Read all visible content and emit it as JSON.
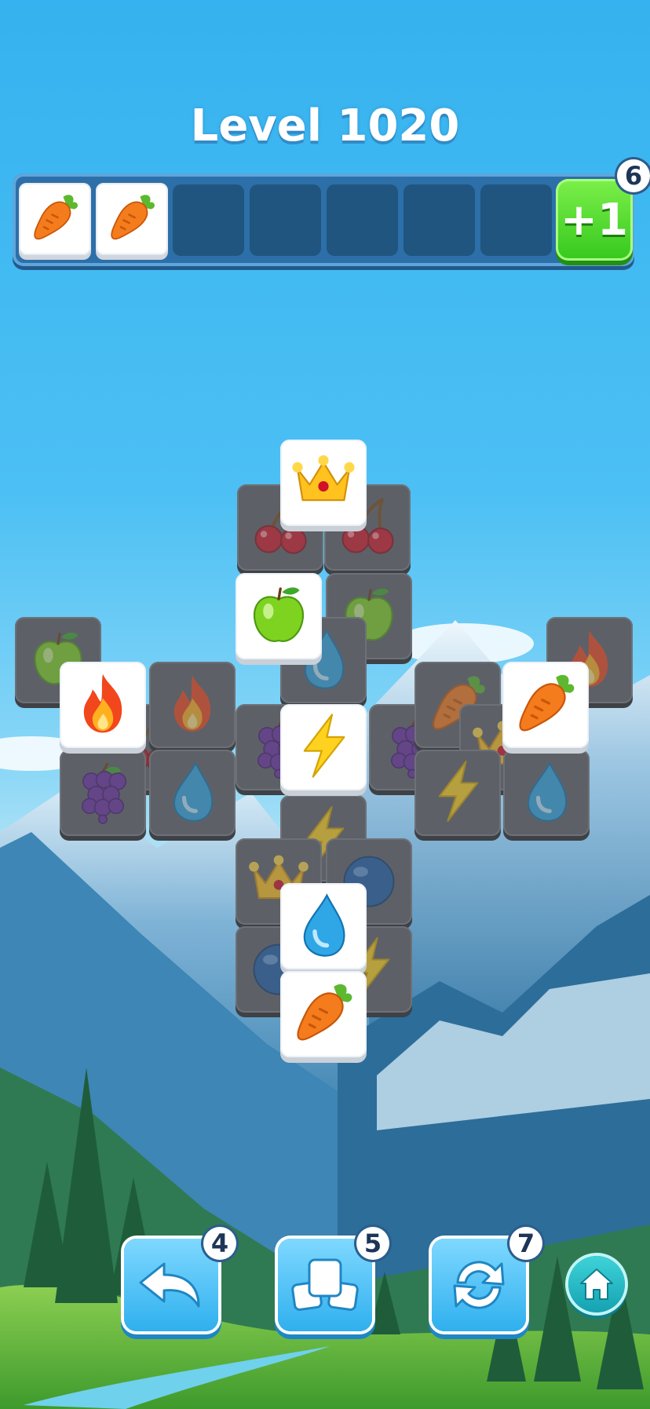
{
  "level": {
    "title": "Level 1020"
  },
  "tray": {
    "slots": [
      "carrot",
      "carrot",
      "",
      "",
      "",
      "",
      ""
    ],
    "extra_slot": {
      "label": "+1",
      "count": "6"
    }
  },
  "tools": {
    "undo": {
      "count": "4",
      "icon": "undo-icon"
    },
    "stack": {
      "count": "5",
      "icon": "stack-icon"
    },
    "shuffle": {
      "count": "7",
      "icon": "shuffle-icon"
    },
    "home": {
      "icon": "home-icon"
    }
  },
  "board": {
    "tiles": [
      {
        "icon": "apple",
        "state": "blocked"
      },
      {
        "icon": "fire",
        "state": "blocked"
      },
      {
        "icon": "cherry",
        "state": "blocked"
      },
      {
        "icon": "fire",
        "state": "blocked"
      },
      {
        "icon": "grapes",
        "state": "blocked"
      },
      {
        "icon": "drop",
        "state": "blocked"
      },
      {
        "icon": "cherry",
        "state": "blocked"
      },
      {
        "icon": "fire",
        "state": "blocked"
      },
      {
        "icon": "cherry",
        "state": "blocked"
      },
      {
        "icon": "apple",
        "state": "blocked"
      },
      {
        "icon": "drop",
        "state": "blocked"
      },
      {
        "icon": "grapes",
        "state": "blocked"
      },
      {
        "icon": "bolt",
        "state": "blocked"
      },
      {
        "icon": "grapes",
        "state": "blocked"
      },
      {
        "icon": "carrot",
        "state": "blocked"
      },
      {
        "icon": "crown",
        "state": "blocked"
      },
      {
        "icon": "bolt",
        "state": "blocked"
      },
      {
        "icon": "drop",
        "state": "blocked"
      },
      {
        "icon": "fire",
        "state": "blocked"
      },
      {
        "icon": "crown",
        "state": "blocked"
      },
      {
        "icon": "ball",
        "state": "blocked"
      },
      {
        "icon": "ball",
        "state": "blocked"
      },
      {
        "icon": "bolt",
        "state": "blocked"
      },
      {
        "icon": "crown",
        "state": "free"
      },
      {
        "icon": "apple",
        "state": "free"
      },
      {
        "icon": "fire",
        "state": "free"
      },
      {
        "icon": "carrot",
        "state": "free"
      },
      {
        "icon": "bolt",
        "state": "free"
      },
      {
        "icon": "drop",
        "state": "free"
      },
      {
        "icon": "carrot",
        "state": "free"
      }
    ]
  },
  "colors": {
    "sky": "#35b2ef",
    "tray": "#2d6fa8",
    "plus_button": "#36c81e",
    "tool_button": "#2fb0ee"
  }
}
